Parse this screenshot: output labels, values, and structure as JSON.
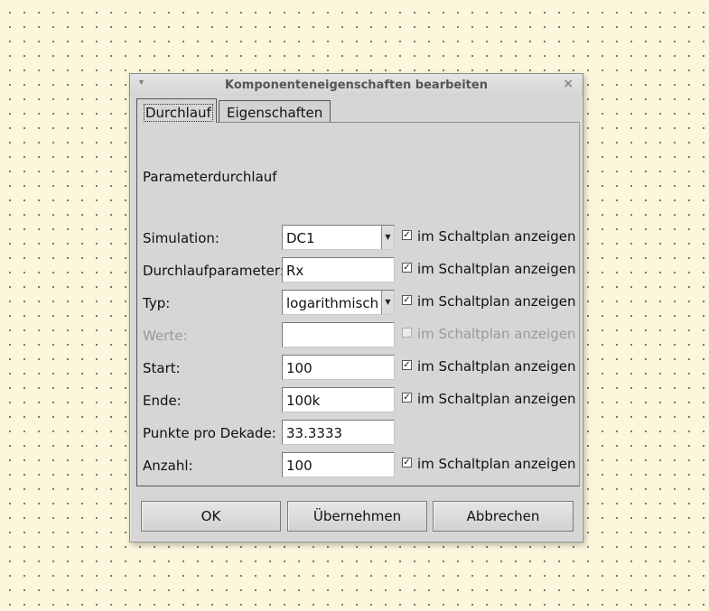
{
  "dialog": {
    "title": "Komponenteneigenschaften bearbeiten",
    "menu_icon": "▾",
    "close_icon": "×"
  },
  "tabs": [
    {
      "label": "Durchlauf",
      "active": true
    },
    {
      "label": "Eigenschaften",
      "active": false
    }
  ],
  "panel": {
    "section_title": "Parameterdurchlauf",
    "show_label": "im Schaltplan anzeigen",
    "fields": [
      {
        "label": "Simulation:",
        "value": "DC1",
        "type": "combo",
        "checked": true,
        "disabled": false
      },
      {
        "label": "Durchlaufparameter:",
        "value": "Rx",
        "type": "text",
        "checked": true,
        "disabled": false
      },
      {
        "label": "Typ:",
        "value": "logarithmisch",
        "type": "combo",
        "checked": true,
        "disabled": false
      },
      {
        "label": "Werte:",
        "value": "",
        "type": "text",
        "checked": false,
        "disabled": true
      },
      {
        "label": "Start:",
        "value": "100",
        "type": "text",
        "checked": true,
        "disabled": false
      },
      {
        "label": "Ende:",
        "value": "100k",
        "type": "text",
        "checked": true,
        "disabled": false
      },
      {
        "label": "Punkte pro Dekade:",
        "value": "33.3333",
        "type": "text",
        "checked": null,
        "disabled": false
      },
      {
        "label": "Anzahl:",
        "value": "100",
        "type": "text",
        "checked": true,
        "disabled": false
      }
    ]
  },
  "buttons": {
    "ok": "OK",
    "apply": "Übernehmen",
    "cancel": "Abbrechen"
  },
  "check_mark": "✓"
}
